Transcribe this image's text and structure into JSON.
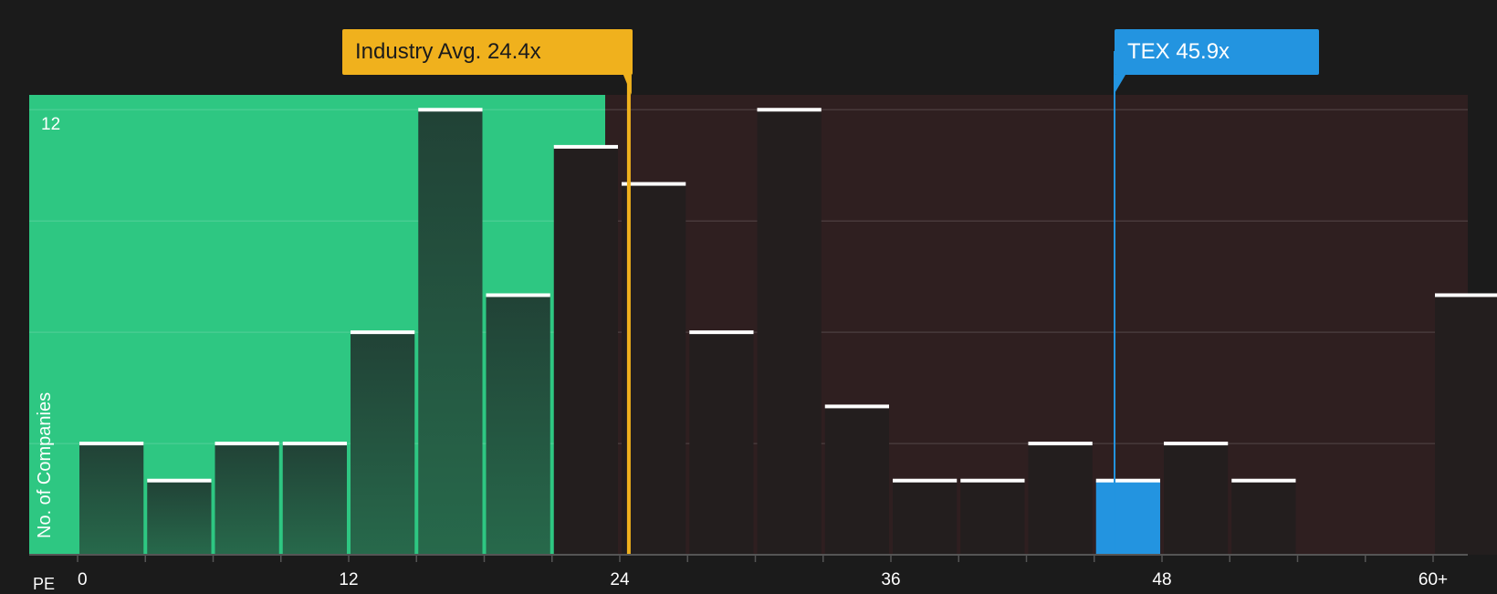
{
  "chart_data": {
    "type": "bar",
    "x_axis_label": "PE",
    "y_axis_label": "No. of Companies",
    "y_tick_labels": [
      "12"
    ],
    "x_tick_labels": [
      "0",
      "12",
      "24",
      "36",
      "48",
      "60+"
    ],
    "x_ticks": [
      0,
      12,
      24,
      36,
      48,
      60
    ],
    "bin_width": 3,
    "xlim": [
      -2.2,
      61.5
    ],
    "ylim": [
      0,
      12.4
    ],
    "bins": [
      {
        "x0": 0,
        "value": 3
      },
      {
        "x0": 3,
        "value": 2
      },
      {
        "x0": 6,
        "value": 3
      },
      {
        "x0": 9,
        "value": 3
      },
      {
        "x0": 12,
        "value": 6
      },
      {
        "x0": 15,
        "value": 12
      },
      {
        "x0": 18,
        "value": 7
      },
      {
        "x0": 21,
        "value": 11
      },
      {
        "x0": 24,
        "value": 10
      },
      {
        "x0": 27,
        "value": 6
      },
      {
        "x0": 30,
        "value": 12
      },
      {
        "x0": 33,
        "value": 4
      },
      {
        "x0": 36,
        "value": 2
      },
      {
        "x0": 39,
        "value": 2
      },
      {
        "x0": 42,
        "value": 3
      },
      {
        "x0": 45,
        "value": 2,
        "highlight": true
      },
      {
        "x0": 48,
        "value": 3
      },
      {
        "x0": 51,
        "value": 2
      },
      {
        "x0": 60,
        "value": 7
      }
    ],
    "industry_avg": {
      "label": "Industry Avg. 24.4x",
      "value": 24.4
    },
    "company": {
      "label": "TEX 45.9x",
      "value": 45.9
    },
    "colors": {
      "background": "#1b1b1b",
      "below_avg_region": "#2ec782",
      "above_avg_region": "#2f1f20",
      "bar_in_green": "#24463a",
      "bar_in_red": "#231e1e",
      "bar_highlight": "#2394e0",
      "industry_marker": "#f0b11d",
      "company_marker": "#2394e0",
      "bar_cap": "#ffffff"
    }
  }
}
